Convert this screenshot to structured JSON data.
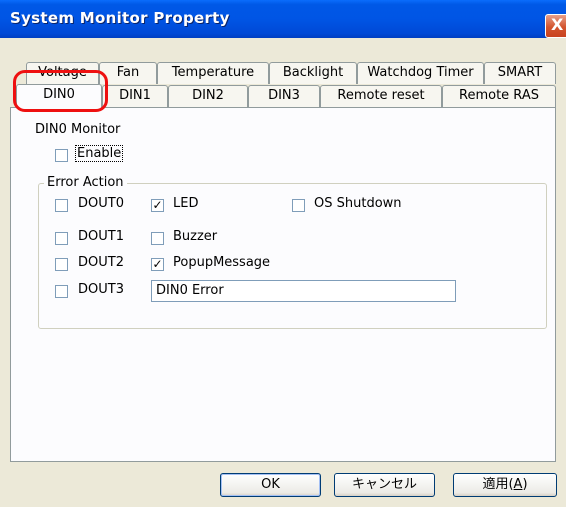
{
  "window": {
    "title": "System Monitor Property",
    "close_glyph": "X"
  },
  "tabs_row1": [
    "Voltage",
    "Fan",
    "Temperature",
    "Backlight",
    "Watchdog Timer",
    "SMART"
  ],
  "tabs_row2": [
    "DIN0",
    "DIN1",
    "DIN2",
    "DIN3",
    "Remote reset",
    "Remote RAS"
  ],
  "active_tab": "DIN0",
  "monitor": {
    "section_label": "DIN0 Monitor",
    "enable_label": "Enable",
    "enable_checked": false
  },
  "error_action": {
    "legend": "Error Action",
    "dout": [
      {
        "label": "DOUT0",
        "checked": false
      },
      {
        "label": "DOUT1",
        "checked": false
      },
      {
        "label": "DOUT2",
        "checked": false
      },
      {
        "label": "DOUT3",
        "checked": false
      }
    ],
    "led": {
      "label": "LED",
      "checked": true
    },
    "buzzer": {
      "label": "Buzzer",
      "checked": false
    },
    "popup": {
      "label": "PopupMessage",
      "checked": true
    },
    "os_shutdown": {
      "label": "OS Shutdown",
      "checked": false
    },
    "message_value": "DIN0 Error"
  },
  "buttons": {
    "ok": "OK",
    "cancel": "キャンセル",
    "apply": "適用(",
    "apply_key": "A",
    "apply_close": ")"
  },
  "colors": {
    "titlebar": "#0055e5",
    "highlight": "#ee1010",
    "dialog_bg": "#ece9d8"
  }
}
